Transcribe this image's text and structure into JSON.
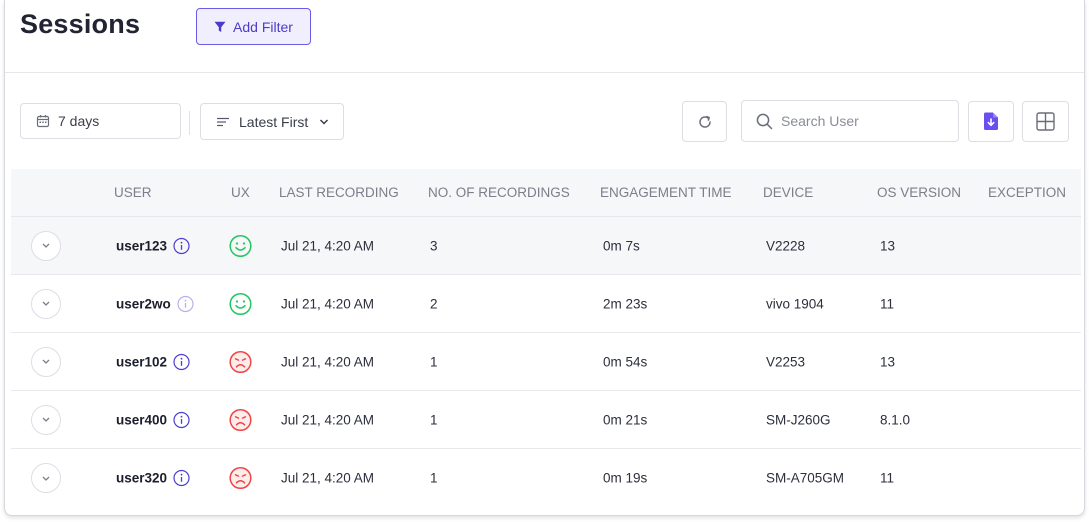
{
  "header": {
    "title": "Sessions",
    "add_filter_label": "Add Filter"
  },
  "toolbar": {
    "date_range": "7 days",
    "sort": "Latest First",
    "search_placeholder": "Search User"
  },
  "colors": {
    "accent": "#6b5ce7",
    "happy": "#22c55e",
    "sad": "#ef4444"
  },
  "table": {
    "columns": [
      "USER",
      "UX",
      "LAST RECORDING",
      "NO. OF RECORDINGS",
      "ENGAGEMENT TIME",
      "DEVICE",
      "OS VERSION",
      "EXCEPTION"
    ],
    "rows": [
      {
        "user": "user123",
        "ux": "happy",
        "last_recording": "Jul 21, 4:20 AM",
        "recordings": "3",
        "engagement": "0m 7s",
        "device": "V2228",
        "os": "13",
        "exception": ""
      },
      {
        "user": "user2wo",
        "ux": "happy",
        "last_recording": "Jul 21, 4:20 AM",
        "recordings": "2",
        "engagement": "2m 23s",
        "device": "vivo 1904",
        "os": "11",
        "exception": ""
      },
      {
        "user": "user102",
        "ux": "sad",
        "last_recording": "Jul 21, 4:20 AM",
        "recordings": "1",
        "engagement": "0m 54s",
        "device": "V2253",
        "os": "13",
        "exception": ""
      },
      {
        "user": "user400",
        "ux": "sad",
        "last_recording": "Jul 21, 4:20 AM",
        "recordings": "1",
        "engagement": "0m 21s",
        "device": "SM-J260G",
        "os": "8.1.0",
        "exception": ""
      },
      {
        "user": "user320",
        "ux": "sad",
        "last_recording": "Jul 21, 4:20 AM",
        "recordings": "1",
        "engagement": "0m 19s",
        "device": "SM-A705GM",
        "os": "11",
        "exception": ""
      }
    ]
  }
}
